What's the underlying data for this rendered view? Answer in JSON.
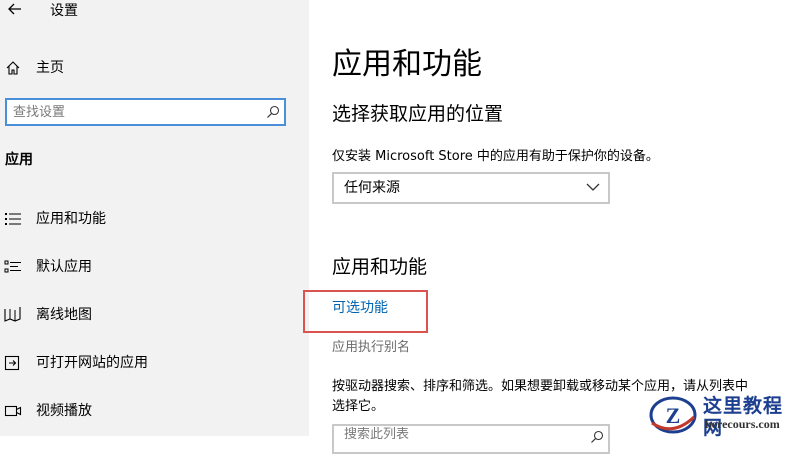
{
  "window": {
    "title": "设置"
  },
  "sidebar": {
    "home_label": "主页",
    "search_placeholder": "查找设置",
    "section_label": "应用",
    "items": [
      {
        "label": "应用和功能",
        "icon": "apps-features-icon"
      },
      {
        "label": "默认应用",
        "icon": "default-apps-icon"
      },
      {
        "label": "离线地图",
        "icon": "offline-maps-icon"
      },
      {
        "label": "可打开网站的应用",
        "icon": "apps-for-websites-icon"
      },
      {
        "label": "视频播放",
        "icon": "video-playback-icon"
      }
    ]
  },
  "main": {
    "title": "应用和功能",
    "install_heading": "选择获取应用的位置",
    "install_desc": "仅安装 Microsoft Store 中的应用有助于保护你的设备。",
    "install_dropdown_value": "任何来源",
    "apps_heading": "应用和功能",
    "optional_features_link": "可选功能",
    "app_alias_link": "应用执行别名",
    "list_desc_line1": "按驱动器搜索、排序和筛选。如果想要卸载或移动某个应用，请从列表中",
    "list_desc_line2": "选择它。",
    "list_search_placeholder": "搜索此列表"
  },
  "watermark": {
    "logo_letter": "Z",
    "cn_text": "这里教程网",
    "en_text": "herecours.com"
  },
  "colors": {
    "sidebar_bg": "#f2f2f2",
    "accent_link": "#0063b1",
    "search_border": "#4a90d9",
    "highlight_border": "#d9534f"
  }
}
